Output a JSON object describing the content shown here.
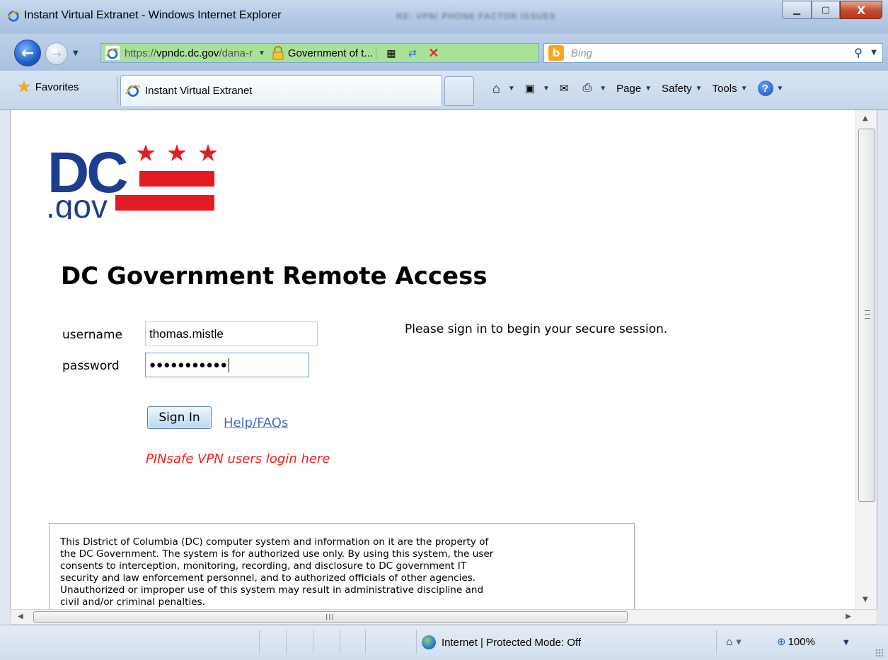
{
  "window": {
    "title": "Instant Virtual Extranet - Windows Internet Explorer",
    "background_tab_text": "RE: VPN/ PHONE FACTOR ISSUES",
    "controls": {
      "minimize": "▁",
      "maximize": "▢",
      "close": "X"
    }
  },
  "navbar": {
    "back_icon": "back-arrow-icon",
    "forward_icon": "forward-arrow-icon",
    "address": {
      "url_prefix": "https://",
      "url_host": "vpndc.dc.gov",
      "url_path": "/dana-r",
      "certificate": "Government of t...",
      "icons": [
        "compatibility-view-icon",
        "refresh-icon",
        "stop-icon"
      ]
    },
    "search": {
      "provider": "Bing",
      "placeholder": "Bing",
      "logo_letter": "b"
    }
  },
  "tabbar": {
    "favorites_label": "Favorites",
    "active_tab_title": "Instant Virtual Extranet",
    "commands": {
      "home": "home-icon",
      "feeds": "feeds-icon",
      "mail": "mail-icon",
      "print": "print-icon",
      "page": "Page",
      "safety": "Safety",
      "tools": "Tools",
      "help": "?"
    }
  },
  "page": {
    "logo": {
      "text_dc": "DC",
      "text_gov": ".gov",
      "star_color": "#e31b23",
      "bar_color": "#e31b23",
      "text_color": "#1f3d8f"
    },
    "heading": "DC Government Remote Access",
    "form": {
      "username_label": "username",
      "username_value": "thomas.mistle",
      "password_label": "password",
      "password_value": "●●●●●●●●●●●",
      "signin_label": "Sign In",
      "help_link": "Help/FAQs",
      "pinsafe_link": "PINsafe VPN users login here"
    },
    "intro_text": "Please sign in to begin your secure session.",
    "disclaimer_lines": [
      "This District of Columbia (DC) computer system and information on it are the property of",
      "the DC Government. The system is for authorized use only. By using this system, the user",
      "consents to interception, monitoring, recording, and disclosure to DC government IT",
      "security and law enforcement personnel, and to authorized officials of other agencies.",
      "Unauthorized or improper use of this system may result in administrative discipline and",
      "civil and/or criminal penalties."
    ]
  },
  "statusbar": {
    "zone_text": "Internet | Protected Mode: Off",
    "zoom": "100%"
  },
  "colors": {
    "accent_red": "#e31b23",
    "dc_blue": "#1f3d8f",
    "link_blue": "#3f6ed0",
    "pinsafe_red": "#ff1a1a"
  }
}
